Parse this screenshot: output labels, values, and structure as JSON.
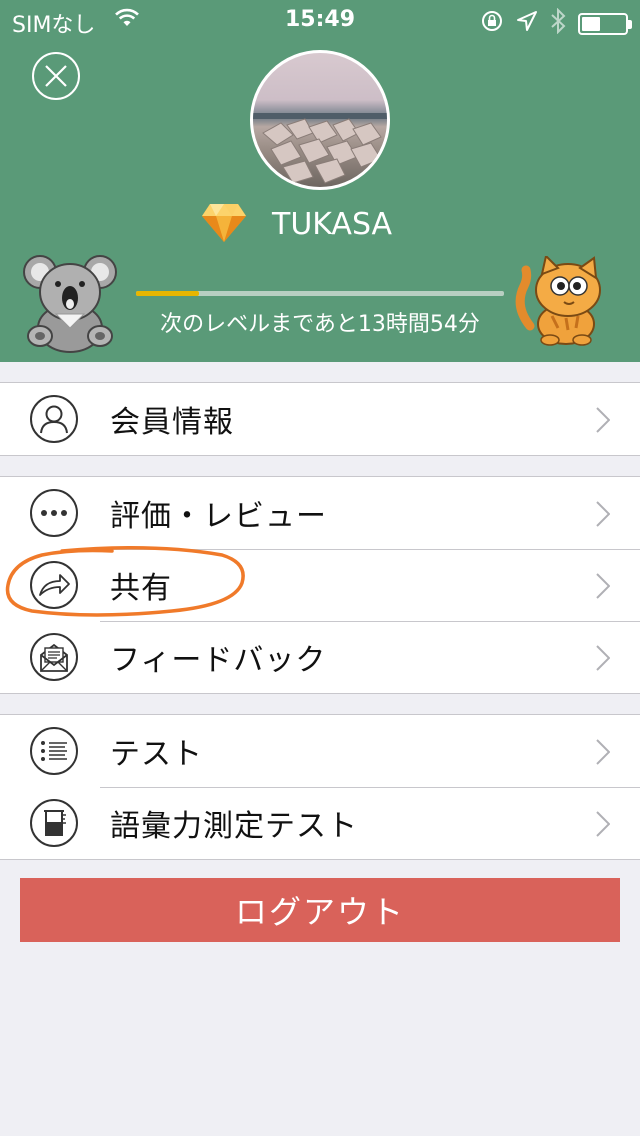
{
  "status_bar": {
    "carrier": "SIMなし",
    "time": "15:49"
  },
  "profile": {
    "username": "TUKASA",
    "level_text": "次のレベルまであと13時間54分",
    "level_progress": 0.17
  },
  "menu": {
    "section1": [
      {
        "label": "会員情報",
        "icon": "person-icon"
      }
    ],
    "section2": [
      {
        "label": "評価・レビュー",
        "icon": "more-dots-icon"
      },
      {
        "label": "共有",
        "icon": "share-arrow-icon"
      },
      {
        "label": "フィードバック",
        "icon": "mail-icon"
      }
    ],
    "section3": [
      {
        "label": "テスト",
        "icon": "list-icon"
      },
      {
        "label": "語彙力測定テスト",
        "icon": "beaker-icon"
      }
    ]
  },
  "logout_label": "ログアウト",
  "colors": {
    "header_bg": "#5a9a78",
    "logout_bg": "#d9625a",
    "progress_fill": "#e8b600",
    "annotation": "#f07a2a"
  }
}
